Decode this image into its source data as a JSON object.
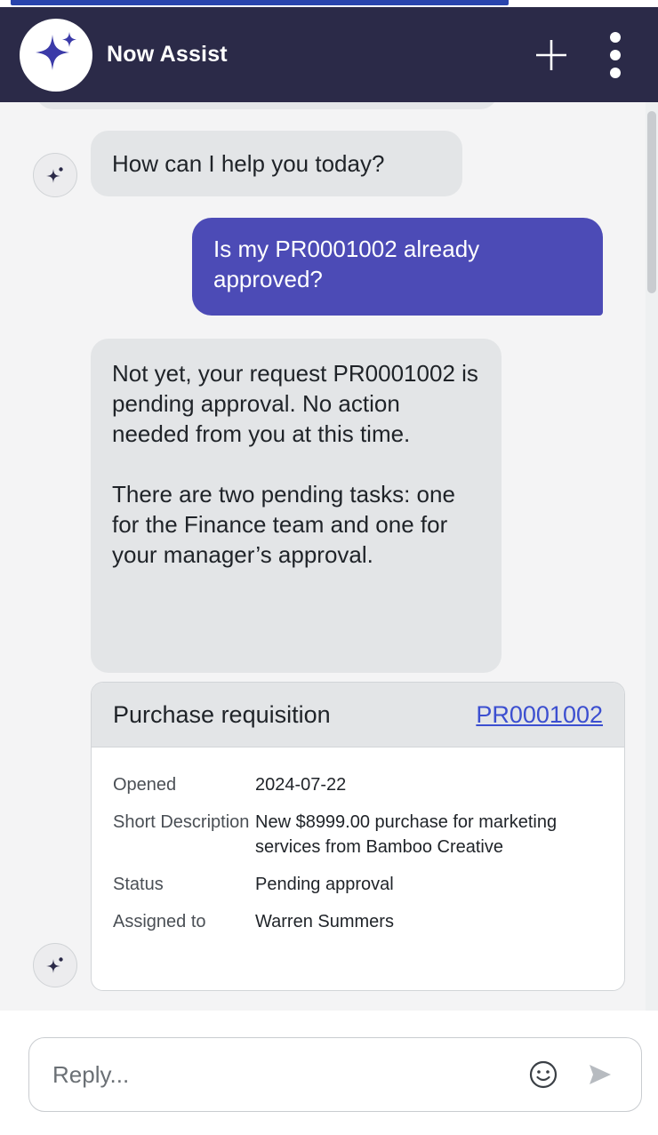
{
  "header": {
    "title": "Now Assist",
    "colors": {
      "background": "#2b2a48",
      "logo_star": "#3b3aa8"
    }
  },
  "conversation": {
    "bot_greeting": "How can I help you today?",
    "user_message": "Is my PR0001002 already approved?",
    "bot_reply": [
      "Not yet, your request PR0001002 is pending approval. No action needed from you at this time.",
      "There are two pending tasks: one for the Finance team and one for your manager’s approval."
    ]
  },
  "card": {
    "title": "Purchase requisition",
    "link": "PR0001002",
    "fields": [
      {
        "label": "Opened",
        "value": "2024-07-22"
      },
      {
        "label": "Short Description",
        "value": "New $8999.00 purchase for marketing services from Bamboo Creative"
      },
      {
        "label": "Status",
        "value": "Pending approval"
      },
      {
        "label": "Assigned to",
        "value": "Warren Summers"
      }
    ]
  },
  "input": {
    "placeholder": "Reply..."
  },
  "icons": {
    "logo": "sparkle-star-icon",
    "new_chat": "plus-icon",
    "menu": "kebab-menu-icon",
    "avatar": "sparkle-icon",
    "emoji": "smiley-icon",
    "send": "send-icon"
  },
  "colors": {
    "user_bubble": "#4c4bb6",
    "bot_bubble": "#e3e5e7",
    "link": "#3c4fd0"
  }
}
